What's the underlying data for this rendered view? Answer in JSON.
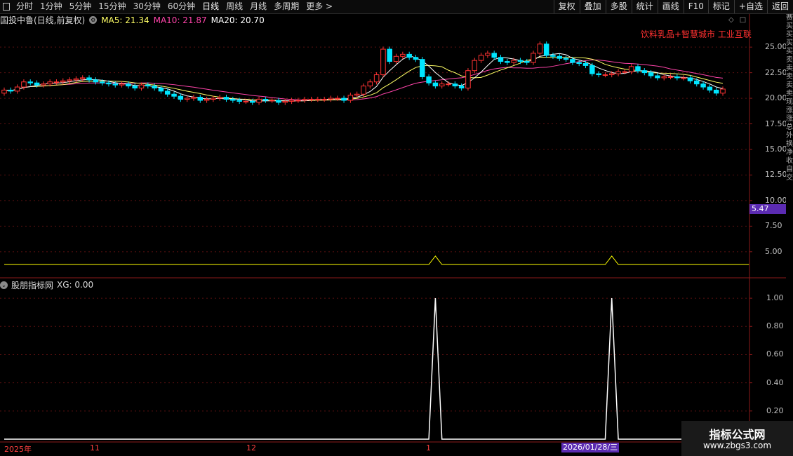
{
  "toolbar": {
    "periods": [
      "分时",
      "1分钟",
      "5分钟",
      "15分钟",
      "30分钟",
      "60分钟",
      "日线",
      "周线",
      "月线",
      "多周期",
      "更多 >"
    ],
    "active_period": "日线",
    "buttons": [
      "复权",
      "叠加",
      "多股",
      "统计",
      "画线",
      "F10",
      "标记",
      "+自选",
      "返回"
    ]
  },
  "main_chart": {
    "stock_name": "国投中鲁(日线,前复权)",
    "ma5_label": "MA5: 21.34",
    "ma10_label": "MA10: 21.87",
    "ma20_label": "MA20: 20.70",
    "concept_tags": "饮料乳品+智慧城市 工业互联",
    "price_axis": [
      "25.00",
      "22.50",
      "20.00",
      "17.50",
      "15.00",
      "12.50",
      "10.00",
      "7.50",
      "5.00"
    ],
    "current_price_marker": "5.47"
  },
  "sub_chart": {
    "indicator_name": "股朋指标网",
    "xg_label": "XG: 0.00",
    "axis": [
      "1.00",
      "0.80",
      "0.60",
      "0.40",
      "0.20"
    ]
  },
  "date_axis": {
    "labels": [
      "2025年",
      "11",
      "12",
      "1"
    ],
    "cursor_date": "2026/01/28/三"
  },
  "watermark": {
    "title": "指标公式网",
    "url": "www.zbgs3.com"
  },
  "colors": {
    "up": "#ff3333",
    "down": "#00e5ff",
    "ma5": "#ffff66",
    "ma10": "#ff44aa",
    "ma20": "#ffffff",
    "signal": "#ffff00",
    "accent": "#5b2bb2"
  },
  "chart_data": [
    {
      "type": "candlestick",
      "title": "国投中鲁(日线,前复权)",
      "ylim": [
        3,
        27
      ],
      "y_ticks": [
        25,
        22.5,
        20,
        17.5,
        15,
        12.5,
        10,
        7.5,
        5
      ],
      "grid": true,
      "close": [
        20.8,
        20.7,
        21.1,
        21.6,
        21.5,
        21.3,
        21.4,
        21.6,
        21.6,
        21.7,
        21.8,
        21.9,
        22.0,
        21.8,
        21.6,
        21.5,
        21.4,
        21.3,
        21.4,
        21.2,
        21.0,
        21.3,
        21.2,
        21.0,
        20.7,
        20.4,
        20.2,
        19.9,
        20.0,
        20.1,
        19.8,
        19.9,
        20.0,
        20.1,
        19.9,
        19.8,
        19.7,
        19.7,
        19.6,
        19.9,
        19.8,
        19.8,
        19.6,
        19.7,
        19.8,
        19.8,
        19.9,
        19.9,
        19.9,
        19.9,
        20.0,
        20.0,
        19.8,
        20.3,
        20.4,
        21.2,
        21.6,
        22.3,
        24.8,
        23.6,
        24.1,
        24.3,
        24.0,
        23.8,
        22.1,
        21.5,
        21.2,
        21.4,
        21.4,
        21.2,
        21.0,
        22.7,
        23.7,
        24.2,
        24.4,
        24.0,
        23.6,
        23.5,
        23.7,
        23.6,
        23.5,
        24.4,
        25.3,
        24.2,
        24.1,
        23.9,
        23.8,
        23.5,
        23.4,
        23.2,
        22.4,
        22.3,
        22.3,
        22.4,
        22.6,
        22.6,
        23.1,
        22.7,
        22.5,
        22.2,
        22.0,
        22.1,
        22.1,
        22.0,
        22.0,
        21.7,
        21.4,
        21.1,
        20.8,
        20.5,
        20.9
      ]
    },
    {
      "type": "line",
      "name": "XG",
      "y_values": [
        0,
        0,
        0,
        0,
        0,
        0,
        0,
        0,
        0,
        0,
        0,
        0,
        0,
        0,
        0,
        0,
        0,
        0,
        0,
        0,
        0,
        0,
        0,
        0,
        0,
        0,
        0,
        0,
        0,
        0,
        0,
        0,
        0,
        0,
        0,
        0,
        0,
        0,
        0,
        0,
        0,
        0,
        0,
        0,
        0,
        0,
        0,
        0,
        0,
        0,
        0,
        0,
        0,
        0,
        0,
        0,
        0,
        0,
        0,
        0,
        0,
        0,
        0,
        0,
        0,
        0,
        1,
        0,
        0,
        0,
        0,
        0,
        0,
        0,
        0,
        0,
        0,
        0,
        0,
        0,
        0,
        0,
        0,
        0,
        0,
        0,
        0,
        0,
        0,
        0,
        0,
        0,
        0,
        1,
        0,
        0,
        0,
        0,
        0,
        0,
        0,
        0,
        0,
        0,
        0,
        0,
        0,
        0,
        0,
        0,
        0,
        0,
        0,
        0,
        0
      ],
      "ylim": [
        0,
        1.1
      ],
      "y_ticks": [
        1,
        0.8,
        0.6,
        0.4,
        0.2
      ]
    }
  ]
}
